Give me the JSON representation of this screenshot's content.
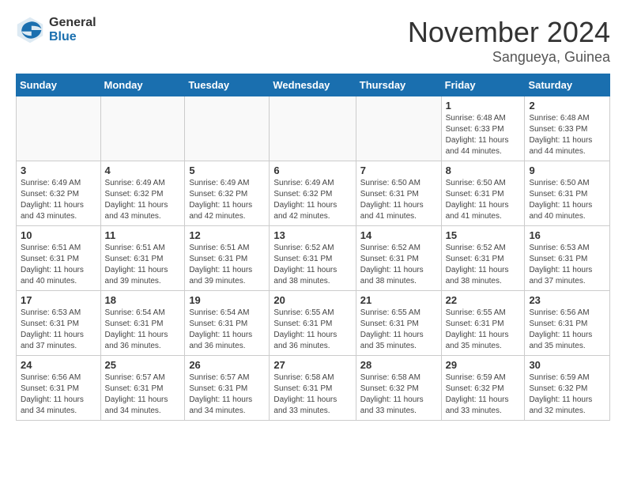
{
  "header": {
    "logo_general": "General",
    "logo_blue": "Blue",
    "month_title": "November 2024",
    "location": "Sangueya, Guinea"
  },
  "weekdays": [
    "Sunday",
    "Monday",
    "Tuesday",
    "Wednesday",
    "Thursday",
    "Friday",
    "Saturday"
  ],
  "weeks": [
    [
      {
        "day": "",
        "info": ""
      },
      {
        "day": "",
        "info": ""
      },
      {
        "day": "",
        "info": ""
      },
      {
        "day": "",
        "info": ""
      },
      {
        "day": "",
        "info": ""
      },
      {
        "day": "1",
        "info": "Sunrise: 6:48 AM\nSunset: 6:33 PM\nDaylight: 11 hours and 44 minutes."
      },
      {
        "day": "2",
        "info": "Sunrise: 6:48 AM\nSunset: 6:33 PM\nDaylight: 11 hours and 44 minutes."
      }
    ],
    [
      {
        "day": "3",
        "info": "Sunrise: 6:49 AM\nSunset: 6:32 PM\nDaylight: 11 hours and 43 minutes."
      },
      {
        "day": "4",
        "info": "Sunrise: 6:49 AM\nSunset: 6:32 PM\nDaylight: 11 hours and 43 minutes."
      },
      {
        "day": "5",
        "info": "Sunrise: 6:49 AM\nSunset: 6:32 PM\nDaylight: 11 hours and 42 minutes."
      },
      {
        "day": "6",
        "info": "Sunrise: 6:49 AM\nSunset: 6:32 PM\nDaylight: 11 hours and 42 minutes."
      },
      {
        "day": "7",
        "info": "Sunrise: 6:50 AM\nSunset: 6:31 PM\nDaylight: 11 hours and 41 minutes."
      },
      {
        "day": "8",
        "info": "Sunrise: 6:50 AM\nSunset: 6:31 PM\nDaylight: 11 hours and 41 minutes."
      },
      {
        "day": "9",
        "info": "Sunrise: 6:50 AM\nSunset: 6:31 PM\nDaylight: 11 hours and 40 minutes."
      }
    ],
    [
      {
        "day": "10",
        "info": "Sunrise: 6:51 AM\nSunset: 6:31 PM\nDaylight: 11 hours and 40 minutes."
      },
      {
        "day": "11",
        "info": "Sunrise: 6:51 AM\nSunset: 6:31 PM\nDaylight: 11 hours and 39 minutes."
      },
      {
        "day": "12",
        "info": "Sunrise: 6:51 AM\nSunset: 6:31 PM\nDaylight: 11 hours and 39 minutes."
      },
      {
        "day": "13",
        "info": "Sunrise: 6:52 AM\nSunset: 6:31 PM\nDaylight: 11 hours and 38 minutes."
      },
      {
        "day": "14",
        "info": "Sunrise: 6:52 AM\nSunset: 6:31 PM\nDaylight: 11 hours and 38 minutes."
      },
      {
        "day": "15",
        "info": "Sunrise: 6:52 AM\nSunset: 6:31 PM\nDaylight: 11 hours and 38 minutes."
      },
      {
        "day": "16",
        "info": "Sunrise: 6:53 AM\nSunset: 6:31 PM\nDaylight: 11 hours and 37 minutes."
      }
    ],
    [
      {
        "day": "17",
        "info": "Sunrise: 6:53 AM\nSunset: 6:31 PM\nDaylight: 11 hours and 37 minutes."
      },
      {
        "day": "18",
        "info": "Sunrise: 6:54 AM\nSunset: 6:31 PM\nDaylight: 11 hours and 36 minutes."
      },
      {
        "day": "19",
        "info": "Sunrise: 6:54 AM\nSunset: 6:31 PM\nDaylight: 11 hours and 36 minutes."
      },
      {
        "day": "20",
        "info": "Sunrise: 6:55 AM\nSunset: 6:31 PM\nDaylight: 11 hours and 36 minutes."
      },
      {
        "day": "21",
        "info": "Sunrise: 6:55 AM\nSunset: 6:31 PM\nDaylight: 11 hours and 35 minutes."
      },
      {
        "day": "22",
        "info": "Sunrise: 6:55 AM\nSunset: 6:31 PM\nDaylight: 11 hours and 35 minutes."
      },
      {
        "day": "23",
        "info": "Sunrise: 6:56 AM\nSunset: 6:31 PM\nDaylight: 11 hours and 35 minutes."
      }
    ],
    [
      {
        "day": "24",
        "info": "Sunrise: 6:56 AM\nSunset: 6:31 PM\nDaylight: 11 hours and 34 minutes."
      },
      {
        "day": "25",
        "info": "Sunrise: 6:57 AM\nSunset: 6:31 PM\nDaylight: 11 hours and 34 minutes."
      },
      {
        "day": "26",
        "info": "Sunrise: 6:57 AM\nSunset: 6:31 PM\nDaylight: 11 hours and 34 minutes."
      },
      {
        "day": "27",
        "info": "Sunrise: 6:58 AM\nSunset: 6:31 PM\nDaylight: 11 hours and 33 minutes."
      },
      {
        "day": "28",
        "info": "Sunrise: 6:58 AM\nSunset: 6:32 PM\nDaylight: 11 hours and 33 minutes."
      },
      {
        "day": "29",
        "info": "Sunrise: 6:59 AM\nSunset: 6:32 PM\nDaylight: 11 hours and 33 minutes."
      },
      {
        "day": "30",
        "info": "Sunrise: 6:59 AM\nSunset: 6:32 PM\nDaylight: 11 hours and 32 minutes."
      }
    ]
  ]
}
